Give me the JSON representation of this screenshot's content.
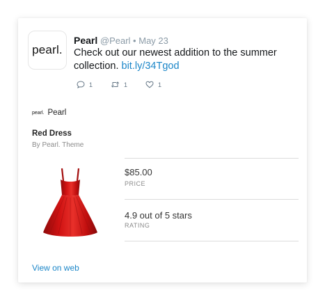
{
  "tweet": {
    "avatar_text": "pearl.",
    "author_name": "Pearl",
    "handle": "@Pearl",
    "separator": "•",
    "date": "May 23",
    "text": "Check out our newest addition to the summer collection.",
    "link_text": "bit.ly/34Tgod",
    "actions": {
      "reply_count": "1",
      "retweet_count": "1",
      "like_count": "1"
    }
  },
  "product": {
    "brand_logo_text": "pearl.",
    "brand_name": "Pearl",
    "title": "Red Dress",
    "subtitle": "By Pearl. Theme",
    "price_value": "$85.00",
    "price_label": "PRICE",
    "rating_value": "4.9 out of 5 stars",
    "rating_label": "RATING",
    "view_on_web": "View on web",
    "image_icon": "red-dress-icon"
  },
  "colors": {
    "link": "#1b86c8",
    "dress": "#d01212",
    "muted": "#8a8a8a"
  }
}
